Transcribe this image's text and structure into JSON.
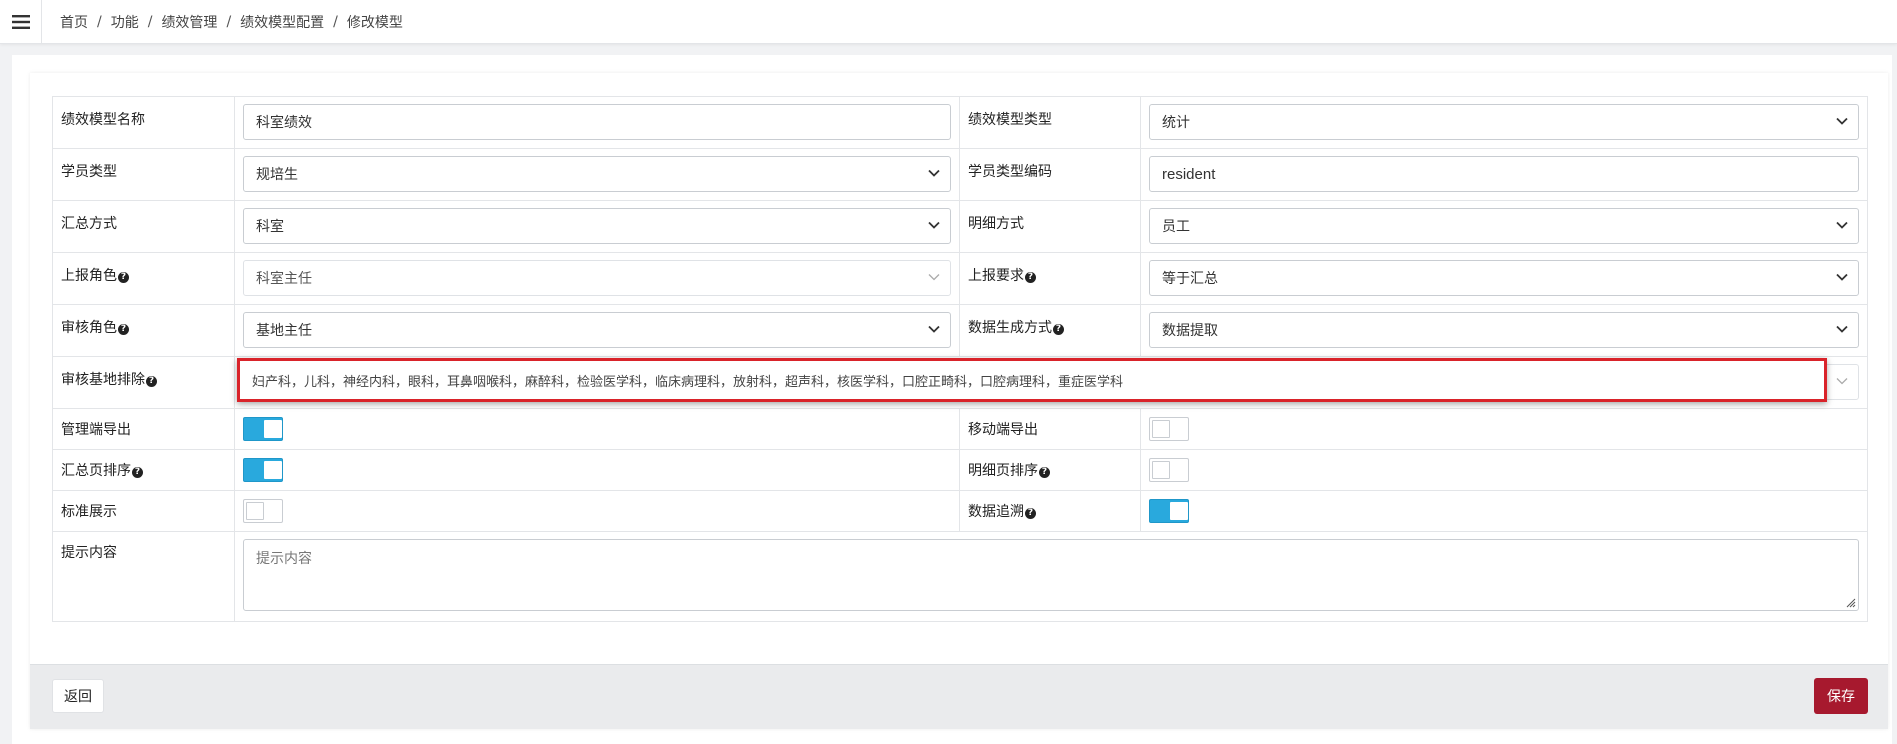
{
  "breadcrumb": {
    "items": [
      "首页",
      "功能",
      "绩效管理",
      "绩效模型配置",
      "修改模型"
    ],
    "separator": "/"
  },
  "form": {
    "model_name": {
      "label": "绩效模型名称",
      "value": "科室绩效"
    },
    "model_type": {
      "label": "绩效模型类型",
      "value": "统计"
    },
    "student_type": {
      "label": "学员类型",
      "value": "规培生"
    },
    "student_type_code": {
      "label": "学员类型编码",
      "value": "resident"
    },
    "summary_method": {
      "label": "汇总方式",
      "value": "科室"
    },
    "detail_method": {
      "label": "明细方式",
      "value": "员工"
    },
    "report_role": {
      "label": "上报角色",
      "value": "科室主任"
    },
    "report_requirement": {
      "label": "上报要求",
      "value": "等于汇总"
    },
    "review_role": {
      "label": "审核角色",
      "value": "基地主任"
    },
    "data_generation": {
      "label": "数据生成方式",
      "value": "数据提取"
    },
    "review_base_exclude": {
      "label": "审核基地排除",
      "value": "妇产科，儿科，神经内科，眼科，耳鼻咽喉科，麻醉科，检验医学科，临床病理科，放射科，超声科，核医学科，口腔正畸科，口腔病理科，重症医学科"
    },
    "admin_export": {
      "label": "管理端导出",
      "on": true
    },
    "mobile_export": {
      "label": "移动端导出",
      "on": false
    },
    "summary_sort": {
      "label": "汇总页排序",
      "on": true
    },
    "detail_sort": {
      "label": "明细页排序",
      "on": false
    },
    "standard_display": {
      "label": "标准展示",
      "on": false
    },
    "data_trace": {
      "label": "数据追溯",
      "on": true
    },
    "hint_content": {
      "label": "提示内容",
      "placeholder": "提示内容"
    }
  },
  "footer": {
    "back_label": "返回",
    "save_label": "保存"
  },
  "colors": {
    "accent": "#29a9dd",
    "save": "#a7192e",
    "highlight": "#d9232a"
  },
  "icons": {
    "menu": "hamburger-icon",
    "help": "question-circle-icon",
    "select": "chevron-down-icon",
    "resize": "resize-grip-icon"
  }
}
